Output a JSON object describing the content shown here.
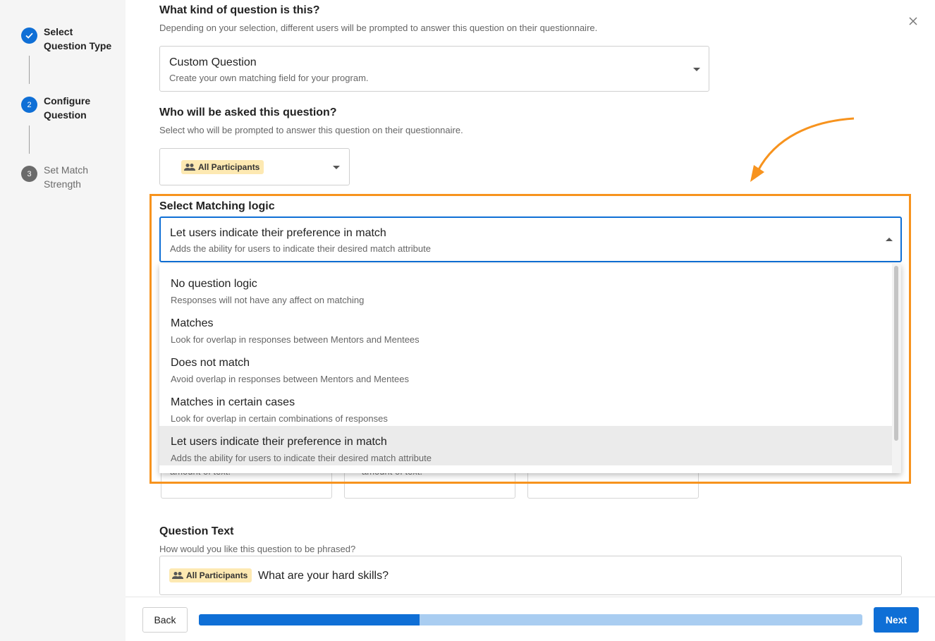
{
  "stepper": {
    "steps": [
      {
        "label": "Select Question Type",
        "status": "complete"
      },
      {
        "label": "Configure Question",
        "status": "active",
        "number": "2"
      },
      {
        "label": "Set Match Strength",
        "status": "pending",
        "number": "3"
      }
    ]
  },
  "question_type": {
    "heading": "What kind of question is this?",
    "subtext": "Depending on your selection, different users will be prompted to answer this question on their questionnaire.",
    "selected_title": "Custom Question",
    "selected_desc": "Create your own matching field for your program."
  },
  "audience": {
    "heading": "Who will be asked this question?",
    "subtext": "Select who will be prompted to answer this question on their questionnaire.",
    "chip_label": "All Participants"
  },
  "matching_logic": {
    "heading": "Select Matching logic",
    "selected_title": "Let users indicate their preference in match",
    "selected_desc": "Adds the ability for users to indicate their desired match attribute",
    "options": [
      {
        "title": "No question logic",
        "desc": "Responses will not have any affect on matching"
      },
      {
        "title": "Matches",
        "desc": "Look for overlap in responses between Mentors and Mentees"
      },
      {
        "title": "Does not match",
        "desc": "Avoid overlap in responses between Mentors and Mentees"
      },
      {
        "title": "Matches in certain cases",
        "desc": "Look for overlap in certain combinations of responses"
      },
      {
        "title": "Let users indicate their preference in match",
        "desc": "Adds the ability for users to indicate their desired match attribute"
      }
    ]
  },
  "hidden_cards": {
    "fragment_left": "amount of text.",
    "fragment_middle": "amount of text."
  },
  "question_text": {
    "heading": "Question Text",
    "subtext": "How would you like this question to be phrased?",
    "chip_label": "All Participants",
    "value": "What are your hard skills?"
  },
  "footer": {
    "back_label": "Back",
    "next_label": "Next",
    "progress": 0.333
  },
  "colors": {
    "primary": "#0f6fd6",
    "highlight": "#f7931e",
    "chip_bg": "#fde9b2"
  }
}
